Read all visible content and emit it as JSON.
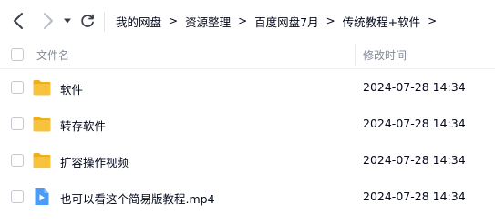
{
  "toolbar": {
    "back_icon": "chevron-left-icon",
    "forward_icon": "chevron-right-icon",
    "dropdown_icon": "caret-down-icon",
    "refresh_icon": "refresh-icon"
  },
  "breadcrumb": {
    "items": [
      "我的网盘",
      "资源整理",
      "百度网盘7月",
      "传统教程+软件"
    ],
    "separator": ">"
  },
  "table": {
    "columns": {
      "name": "文件名",
      "modified": "修改时间"
    },
    "rows": [
      {
        "name": "软件",
        "type": "folder",
        "icon": "folder-icon",
        "modified": "2024-07-28 14:34"
      },
      {
        "name": "转存软件",
        "type": "folder",
        "icon": "folder-icon",
        "modified": "2024-07-28 14:34"
      },
      {
        "name": "扩容操作视频",
        "type": "folder",
        "icon": "folder-icon",
        "modified": "2024-07-28 14:34"
      },
      {
        "name": "也可以看这个简易版教程.mp4",
        "type": "video",
        "icon": "video-file-icon",
        "modified": "2024-07-28 14:34"
      }
    ]
  },
  "colors": {
    "folder": "#f7c33c",
    "folder_tab": "#f0ad1f",
    "video": "#4c9cf5",
    "text": "#03081a",
    "muted_text": "#818999",
    "disabled_icon": "#b8bcc6"
  }
}
